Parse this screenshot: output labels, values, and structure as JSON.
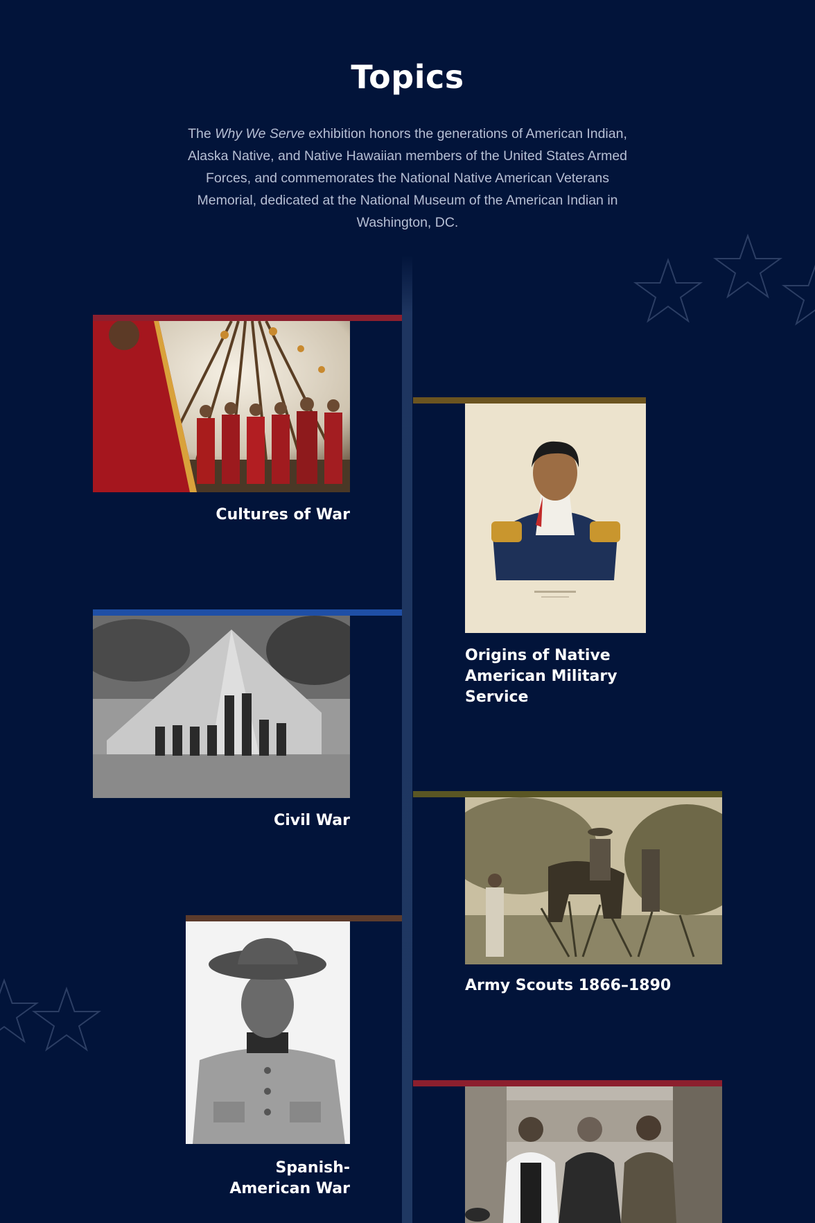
{
  "header": {
    "title": "Topics",
    "intro_before": "The ",
    "intro_italic": "Why We Serve",
    "intro_after": " exhibition honors the generations of American Indian, Alaska Native, and Native Hawaiian members of the United States Armed Forces, and commemorates the National Native American Veterans Memorial, dedicated at the National Museum of the American Indian in Washington, DC."
  },
  "decor": {
    "star_icons": [
      "star-outline-icon"
    ],
    "colors": {
      "background": "#02143a",
      "spine": "#1f3862",
      "star_stroke": "#2c3e64"
    }
  },
  "topics": [
    {
      "title": "Cultures of War",
      "side": "left",
      "accent": "#8c1f2e",
      "image_icon": "tipi-ceremony-photo"
    },
    {
      "title": "Origins of Native American Military Service",
      "side": "right",
      "accent": "#6b5420",
      "image_icon": "officer-portrait-painting"
    },
    {
      "title": "Civil War",
      "side": "left",
      "accent": "#1f4fa6",
      "image_icon": "civil-war-tent-photo"
    },
    {
      "title": "Army Scouts 1866–1890",
      "side": "right",
      "accent": "#5a5624",
      "image_icon": "scouts-on-horseback-photo"
    },
    {
      "title": "Spanish-American War",
      "side": "left",
      "accent": "#5c3b2c",
      "image_icon": "soldier-portrait-photo"
    },
    {
      "title": "",
      "side": "right",
      "accent": "#8c1f2e",
      "image_icon": "group-portrait-photo"
    }
  ]
}
